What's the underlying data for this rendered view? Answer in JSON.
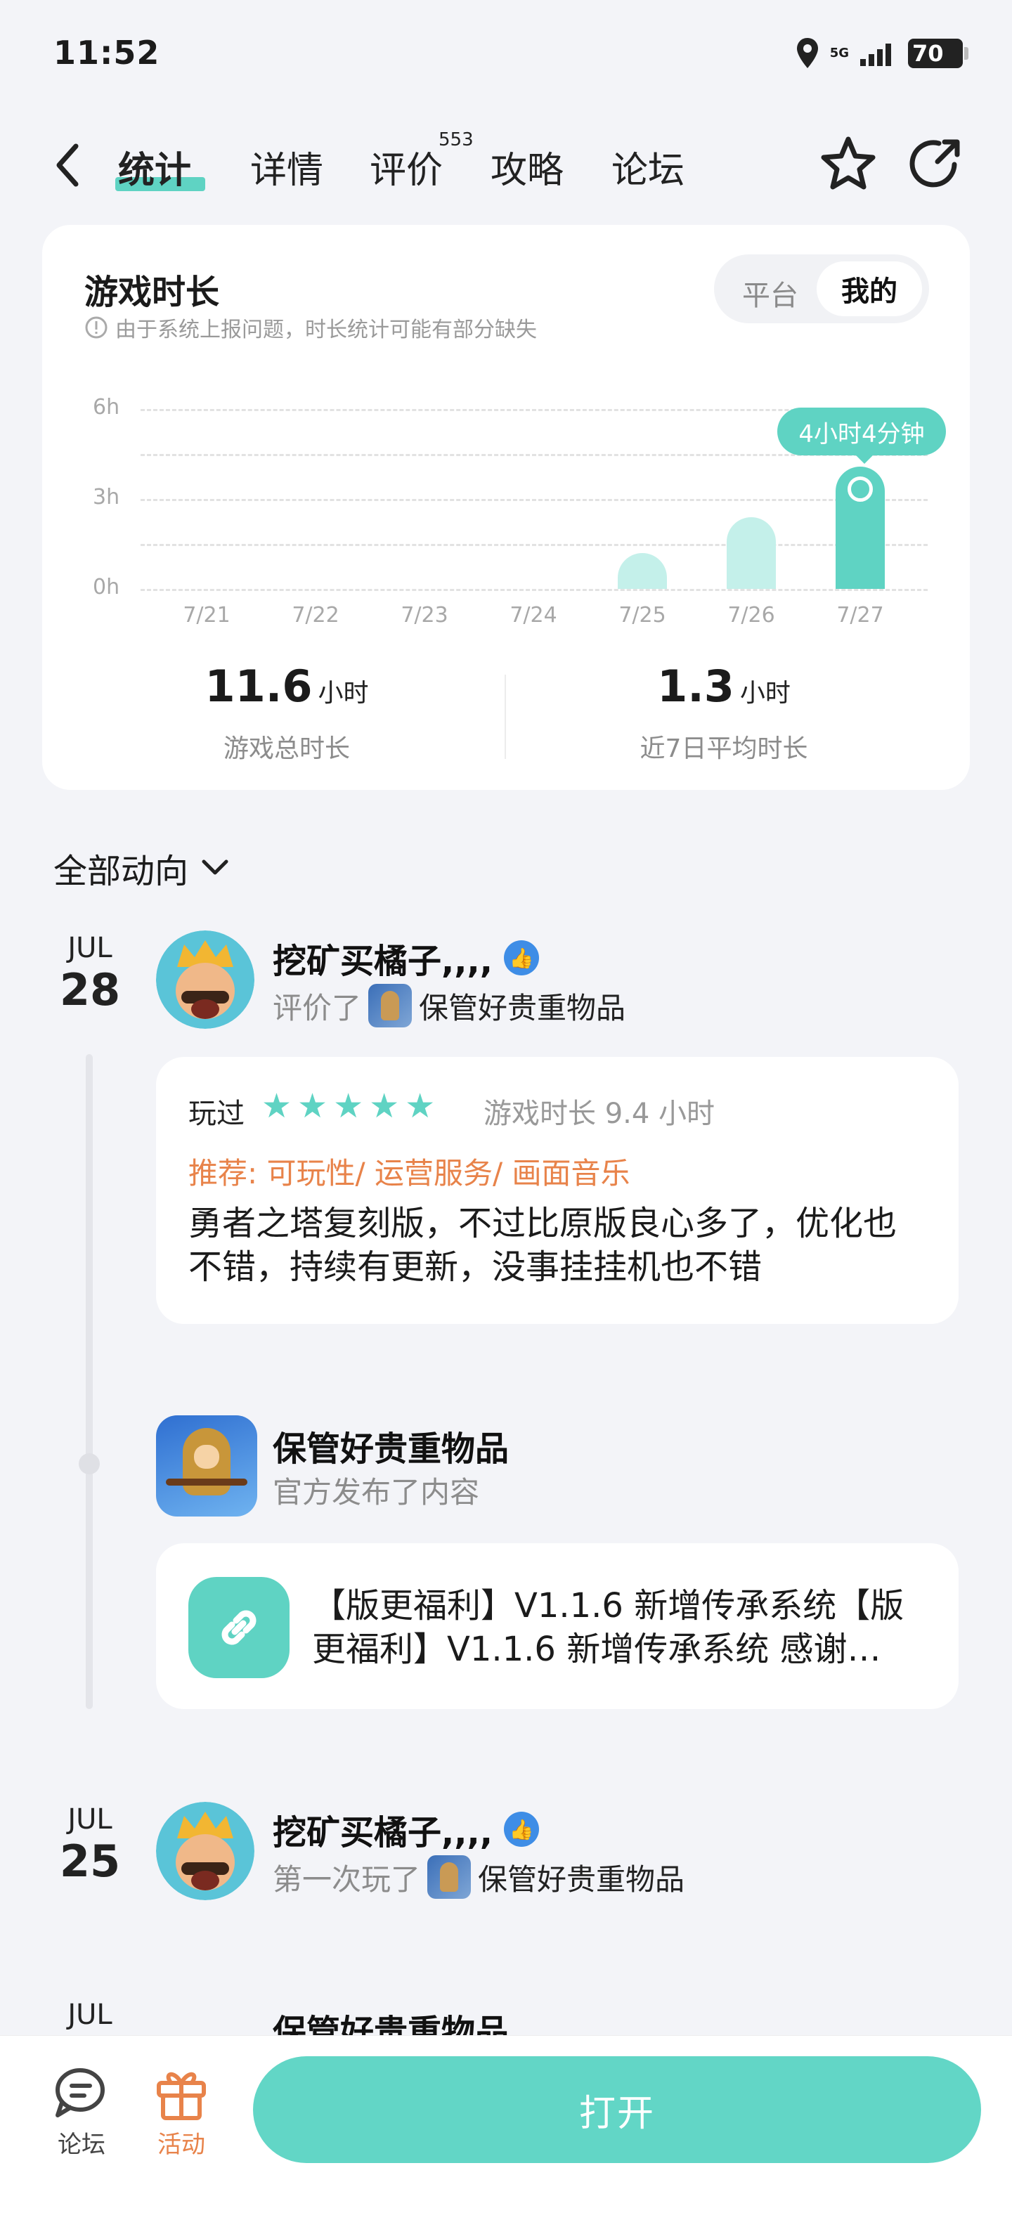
{
  "status_bar": {
    "time": "11:52",
    "network": "5G",
    "battery": "70"
  },
  "nav": {
    "tabs": [
      {
        "label": "统计",
        "active": true
      },
      {
        "label": "详情"
      },
      {
        "label": "评价"
      },
      {
        "label": "攻略"
      },
      {
        "label": "论坛"
      }
    ],
    "review_count_badge": "553"
  },
  "playtime_card": {
    "title": "游戏时长",
    "note": "由于系统上报问题，时长统计可能有部分缺失",
    "toggle": {
      "options": [
        "平台",
        "我的"
      ],
      "selected": "我的"
    },
    "tooltip": "4小时4分钟",
    "total": {
      "value": "11.6",
      "unit": "小时",
      "label": "游戏总时长"
    },
    "average": {
      "value": "1.3",
      "unit": "小时",
      "label": "近7日平均时长"
    }
  },
  "chart_data": {
    "type": "bar",
    "categories": [
      "7/21",
      "7/22",
      "7/23",
      "7/24",
      "7/25",
      "7/26",
      "7/27"
    ],
    "values": [
      0,
      0,
      0,
      0,
      1.2,
      2.4,
      4.07
    ],
    "y_ticks": [
      "0h",
      "3h",
      "6h"
    ],
    "ylim": [
      0,
      6
    ],
    "grid": true,
    "colors": {
      "bar": "#c4f0ea",
      "highlight": "#5fd3c3"
    }
  },
  "feed": {
    "filter_label": "全部动向",
    "entries": [
      {
        "month": "JUL",
        "day": "28",
        "user": "挖矿买橘子,,,,",
        "action": "评价了",
        "game": "保管好贵重物品",
        "review": {
          "played_label": "玩过",
          "stars": 5,
          "playtime": "游戏时长 9.4 小时",
          "recommend": "推荐: 可玩性/ 运营服务/ 画面音乐",
          "text": "勇者之塔复刻版，不过比原版良心多了，优化也不错，持续有更新，没事挂挂机也不错"
        }
      },
      {
        "game_title": "保管好贵重物品",
        "action": "官方发布了内容",
        "post": "【版更福利】V1.1.6 新增传承系统【版更福利】V1.1.6 新增传承系统 感谢…"
      },
      {
        "month": "JUL",
        "day": "25",
        "user": "挖矿买橘子,,,,",
        "action": "第一次玩了",
        "game": "保管好贵重物品"
      },
      {
        "month": "JUL",
        "game_title": "保管好贵重物品"
      }
    ]
  },
  "bottom_bar": {
    "forum_label": "论坛",
    "events_label": "活动",
    "open_button": "打开"
  }
}
